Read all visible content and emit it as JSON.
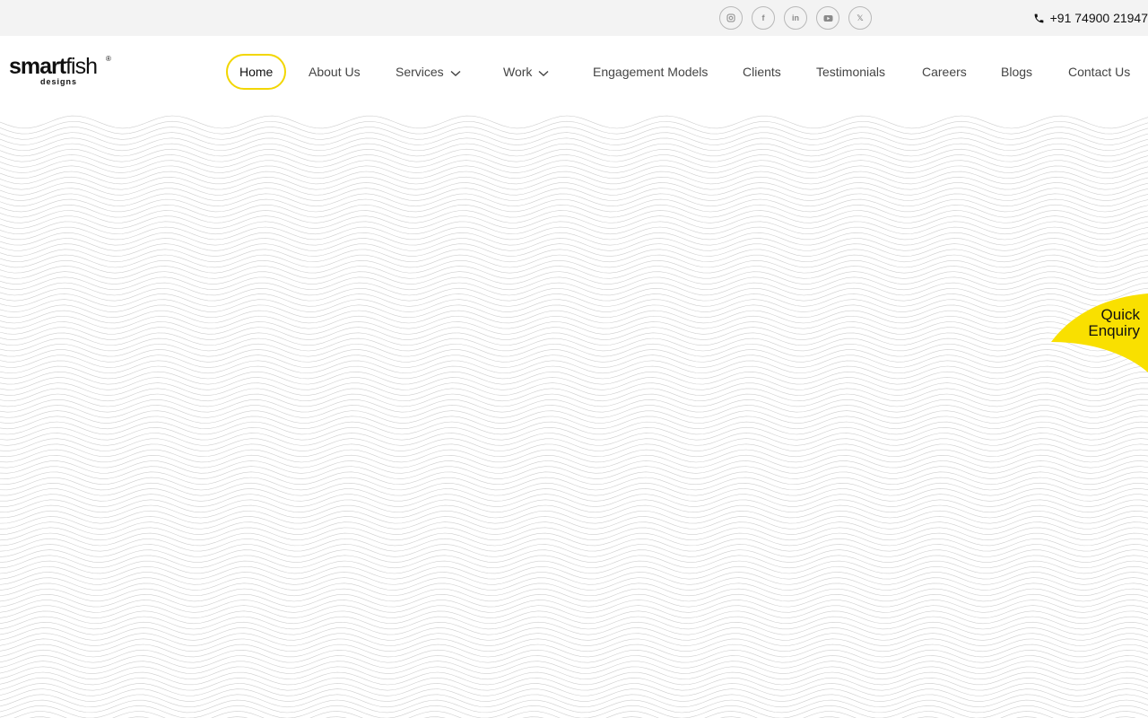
{
  "topbar": {
    "social": [
      {
        "name": "instagram",
        "icon": "instagram-icon"
      },
      {
        "name": "facebook",
        "icon": "facebook-icon",
        "glyph": "f"
      },
      {
        "name": "linkedin",
        "icon": "linkedin-icon",
        "glyph": "in"
      },
      {
        "name": "youtube",
        "icon": "youtube-icon"
      },
      {
        "name": "x",
        "icon": "x-icon",
        "glyph": "𝕏"
      }
    ],
    "phone": "+91 74900 21947"
  },
  "logo": {
    "smart": "smart",
    "fish": "fish",
    "reg": "®",
    "sub": "designs"
  },
  "nav": {
    "items": [
      {
        "label": "Home",
        "active": true
      },
      {
        "label": "About Us"
      },
      {
        "label": "Services",
        "dropdown": true
      },
      {
        "label": "Work",
        "dropdown": true
      },
      {
        "label": "Engagement Models"
      },
      {
        "label": "Clients"
      },
      {
        "label": "Testimonials"
      },
      {
        "label": "Careers"
      },
      {
        "label": "Blogs"
      },
      {
        "label": "Contact Us"
      }
    ]
  },
  "quick_enquiry": {
    "line1": "Quick",
    "line2": "Enquiry"
  },
  "colors": {
    "accent": "#f2d600",
    "topbar_bg": "#f3f3f3",
    "wave_line": "#cfcfcf"
  }
}
